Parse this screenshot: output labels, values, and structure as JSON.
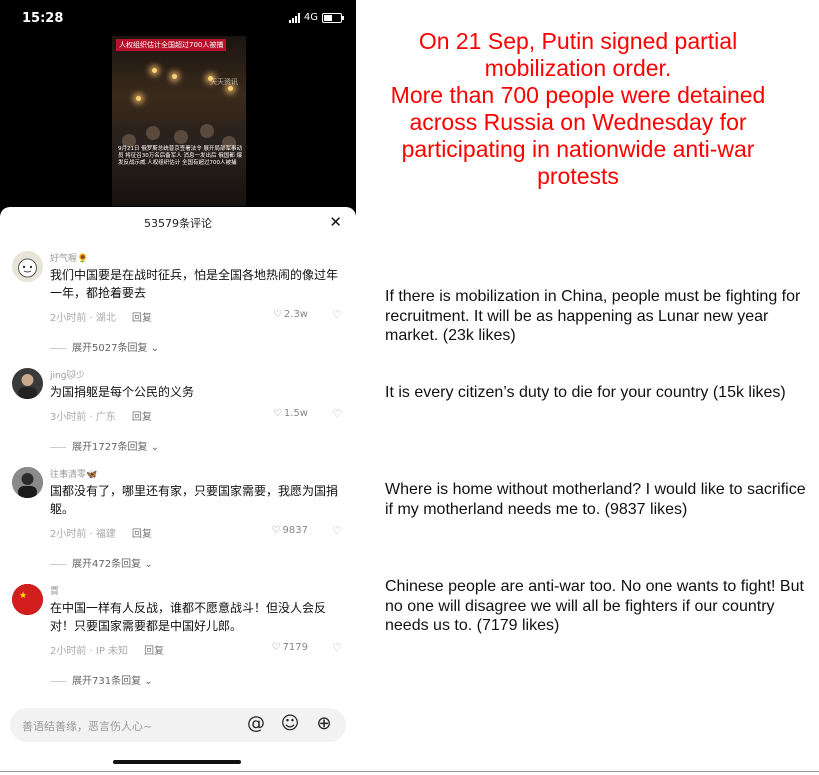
{
  "status_bar": {
    "time": "15:28",
    "network": "4G"
  },
  "video": {
    "banner": "人权组织估计全国超过700人被捕",
    "watermark": "天天资讯",
    "caption": "9月21日 俄罗斯总统普京签署法令 展开局部军事动员 将征召30万名后备军人 消息一发出后 俄国都 爆发反战示威 人权组织估计 全国有超过700人被捕"
  },
  "comments_panel": {
    "title": "53579条评论",
    "close_icon": "close-icon",
    "comments": [
      {
        "user": "好气喔🌻",
        "text": "我们中国要是在战时征兵，怕是全国各地热闹的像过年一年，都抢着要去",
        "time_loc": "2小时前 · 湖北",
        "reply": "回复",
        "likes": "2.3w",
        "expand": "展开5027条回复"
      },
      {
        "user": "jing🐱少",
        "text": "为国捐躯是每个公民的义务",
        "time_loc": "3小时前 · 广东",
        "reply": "回复",
        "likes": "1.5w",
        "expand": "展开1727条回复"
      },
      {
        "user": "往事清零🦋",
        "text": "国都没有了，哪里还有家，只要国家需要，我愿为国捐躯。",
        "time_loc": "2小时前 · 福建",
        "reply": "回复",
        "likes": "9837",
        "expand": "展开472条回复"
      },
      {
        "user": "賈",
        "text": "在中国一样有人反战，谁都不愿意战斗！但没人会反对！只要国家需要都是中国好儿郎。",
        "time_loc": "2小时前 · IP 未知",
        "reply": "回复",
        "likes": "7179",
        "expand": "展开731条回复"
      }
    ],
    "input_placeholder": "善语结善缘，恶言伤人心~"
  },
  "annotation": {
    "headline": "On 21 Sep, Putin signed partial mobilization order.\nMore than 700 people were detained across Russia on Wednesday for participating in nationwide anti-war protests",
    "translations": [
      "If there is mobilization in China, people must be fighting for recruitment. It will be as happening as Lunar new year market. (23k likes)",
      "It is every citizen’s duty to die for your country (15k likes)",
      "Where is home without motherland? I would like to sacrifice if my motherland needs me to. (9837 likes)",
      "Chinese people are anti-war too. No one wants to fight! But no one will disagree we will all be fighters if our country needs us to. (7179 likes)"
    ]
  },
  "colors": {
    "headline": "#ff0000",
    "banner": "#b8102a"
  }
}
